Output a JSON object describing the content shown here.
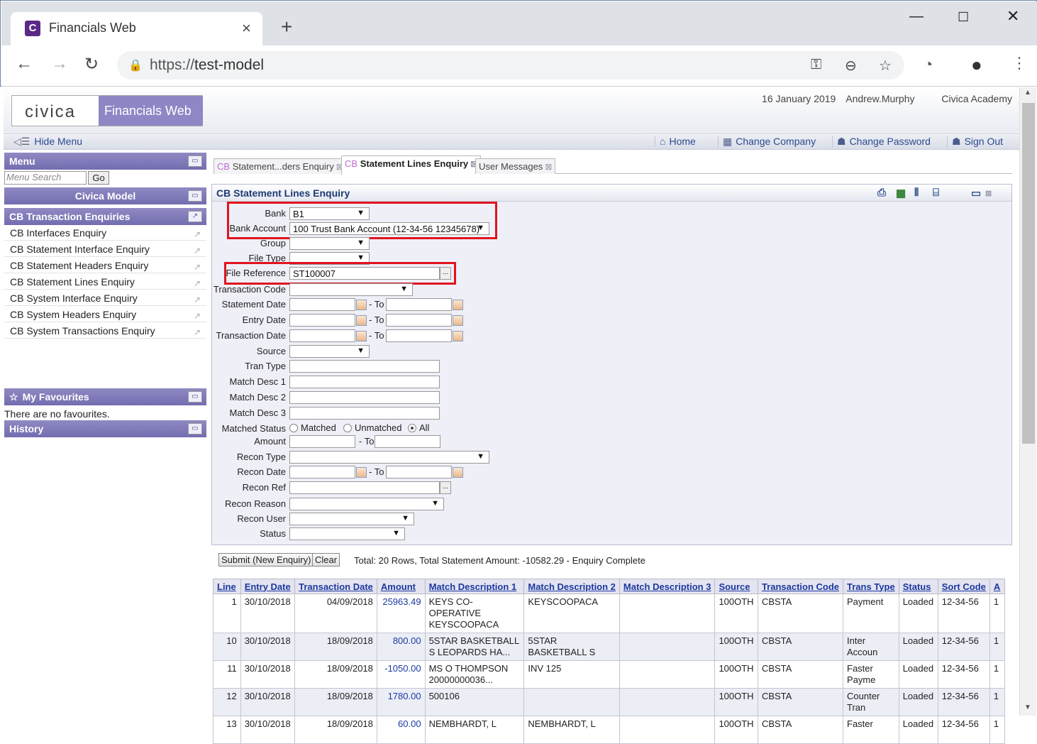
{
  "browser": {
    "tab_title": "Financials Web",
    "tab_favicon": "C",
    "url_prefix": "https://",
    "url_host": "test-model",
    "icons": [
      "back-icon",
      "forward-icon",
      "reload-icon",
      "lock-icon",
      "key-icon",
      "zoom-icon",
      "star-icon",
      "extension-icon",
      "profile-icon",
      "menu-icon"
    ]
  },
  "header": {
    "logo_text": "civica",
    "app_name": "Financials Web",
    "date": "16 January 2019",
    "user": "Andrew.Murphy",
    "org": "Civica Academy"
  },
  "toolbar": {
    "hide_menu": "Hide Menu",
    "home": "Home",
    "change_company": "Change Company",
    "change_password": "Change Password",
    "sign_out": "Sign Out"
  },
  "sidebar": {
    "menu_title": "Menu",
    "search_placeholder": "Menu Search",
    "go_label": "Go",
    "model_title": "Civica Model",
    "section_title": "CB Transaction Enquiries",
    "items": [
      "CB Interfaces Enquiry",
      "CB Statement Interface Enquiry",
      "CB Statement Headers Enquiry",
      "CB Statement Lines Enquiry",
      "CB System Interface Enquiry",
      "CB System Headers Enquiry",
      "CB System Transactions Enquiry"
    ],
    "favourites_title": "My Favourites",
    "no_favourites": "There are no favourites.",
    "history_title": "History"
  },
  "content_tabs": [
    {
      "prefix": "CB",
      "label": "Statement...ders Enquiry"
    },
    {
      "prefix": "CB",
      "label": "Statement Lines Enquiry"
    },
    {
      "prefix": "",
      "label": "User Messages"
    }
  ],
  "panel": {
    "title": "CB Statement Lines Enquiry",
    "labels": {
      "bank": "Bank",
      "bank_account": "Bank Account",
      "group": "Group",
      "file_type": "File Type",
      "file_reference": "File Reference",
      "transaction_code": "Transaction Code",
      "statement_date": "Statement Date",
      "entry_date": "Entry Date",
      "transaction_date": "Transaction Date",
      "source": "Source",
      "tran_type": "Tran Type",
      "match_desc_1": "Match Desc 1",
      "match_desc_2": "Match Desc 2",
      "match_desc_3": "Match Desc 3",
      "matched_status": "Matched Status",
      "amount": "Amount",
      "recon_type": "Recon Type",
      "recon_date": "Recon Date",
      "recon_ref": "Recon Ref",
      "recon_reason": "Recon Reason",
      "recon_user": "Recon User",
      "status": "Status",
      "to": "- To"
    },
    "values": {
      "bank": "B1",
      "bank_account": "100 Trust Bank Account (12-34-56 12345678)",
      "file_reference": "ST100007"
    },
    "radios": {
      "matched": "Matched",
      "unmatched": "Unmatched",
      "all": "All",
      "selected": "All"
    },
    "submit_label": "Submit (New Enquiry)",
    "clear_label": "Clear",
    "status_text": "Total: 20 Rows, Total Statement Amount: -10582.29 - Enquiry Complete"
  },
  "table": {
    "columns": [
      "Line",
      "Entry Date",
      "Transaction Date",
      "Amount",
      "Match Description 1",
      "Match Description 2",
      "Match Description 3",
      "Source",
      "Transaction Code",
      "Trans Type",
      "Status",
      "Sort Code",
      "A"
    ],
    "rows": [
      {
        "line": "1",
        "entry": "30/10/2018",
        "tran": "04/09/2018",
        "amount": "25963.49",
        "md1": "KEYS CO-OPERATIVE KEYSCOOPACA",
        "md2": "KEYSCOOPACA",
        "md3": "",
        "source": "100OTH",
        "code": "CBSTA",
        "type": "Payment",
        "status": "Loaded",
        "sort": "12-34-56",
        "a": "1"
      },
      {
        "line": "10",
        "entry": "30/10/2018",
        "tran": "18/09/2018",
        "amount": "800.00",
        "md1": "5STAR BASKETBALL S LEOPARDS HA...",
        "md2": "5STAR BASKETBALL S",
        "md3": "",
        "source": "100OTH",
        "code": "CBSTA",
        "type": "Inter Accoun",
        "status": "Loaded",
        "sort": "12-34-56",
        "a": "1"
      },
      {
        "line": "11",
        "entry": "30/10/2018",
        "tran": "18/09/2018",
        "amount": "-1050.00",
        "md1": "MS O THOMPSON 20000000036...",
        "md2": "INV 125",
        "md3": "",
        "source": "100OTH",
        "code": "CBSTA",
        "type": "Faster Payme",
        "status": "Loaded",
        "sort": "12-34-56",
        "a": "1"
      },
      {
        "line": "12",
        "entry": "30/10/2018",
        "tran": "18/09/2018",
        "amount": "1780.00",
        "md1": "500106",
        "md2": "",
        "md3": "",
        "source": "100OTH",
        "code": "CBSTA",
        "type": "Counter Tran",
        "status": "Loaded",
        "sort": "12-34-56",
        "a": "1"
      },
      {
        "line": "13",
        "entry": "30/10/2018",
        "tran": "18/09/2018",
        "amount": "60.00",
        "md1": "NEMBHARDT, L",
        "md2": "NEMBHARDT, L",
        "md3": "",
        "source": "100OTH",
        "code": "CBSTA",
        "type": "Faster",
        "status": "Loaded",
        "sort": "12-34-56",
        "a": "1"
      }
    ]
  }
}
